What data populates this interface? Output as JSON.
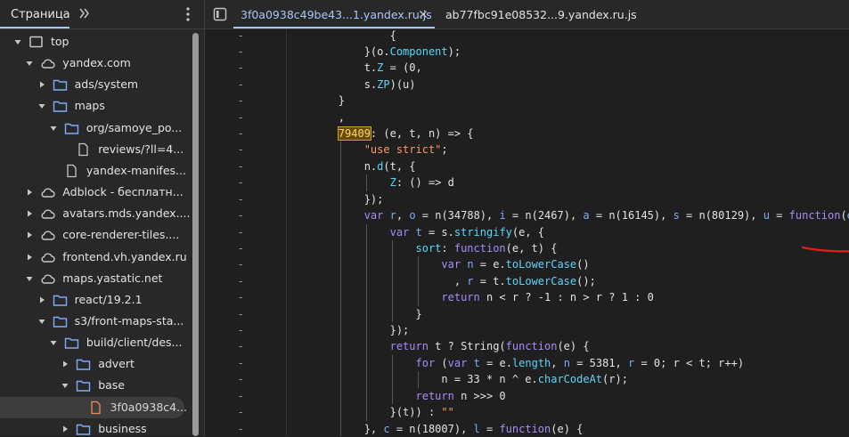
{
  "navigator": {
    "tab_label": "Страница",
    "tree": [
      {
        "label": "top",
        "icon": "frame-icon",
        "indent": 0,
        "arrow": "down"
      },
      {
        "label": "yandex.com",
        "icon": "cloud-icon",
        "indent": 1,
        "arrow": "down"
      },
      {
        "label": "ads/system",
        "icon": "folder-icon",
        "indent": 2,
        "arrow": "right"
      },
      {
        "label": "maps",
        "icon": "folder-icon",
        "indent": 2,
        "arrow": "down"
      },
      {
        "label": "org/samoye_po...",
        "icon": "folder-icon",
        "indent": 3,
        "arrow": "down"
      },
      {
        "label": "reviews/?ll=4...",
        "icon": "file-icon",
        "indent": 4,
        "arrow": "none"
      },
      {
        "label": "yandex-manifes...",
        "icon": "file-icon",
        "indent": 3,
        "arrow": "none"
      },
      {
        "label": "Adblock - бесплатн...",
        "icon": "cloud-icon",
        "indent": 1,
        "arrow": "right"
      },
      {
        "label": "avatars.mds.yandex....",
        "icon": "cloud-icon",
        "indent": 1,
        "arrow": "right"
      },
      {
        "label": "core-renderer-tiles....",
        "icon": "cloud-icon",
        "indent": 1,
        "arrow": "right"
      },
      {
        "label": "frontend.vh.yandex.ru",
        "icon": "cloud-icon",
        "indent": 1,
        "arrow": "right"
      },
      {
        "label": "maps.yastatic.net",
        "icon": "cloud-icon",
        "indent": 1,
        "arrow": "down"
      },
      {
        "label": "react/19.2.1",
        "icon": "folder-icon",
        "indent": 2,
        "arrow": "right"
      },
      {
        "label": "s3/front-maps-sta...",
        "icon": "folder-icon",
        "indent": 2,
        "arrow": "down"
      },
      {
        "label": "build/client/des...",
        "icon": "folder-icon",
        "indent": 3,
        "arrow": "down"
      },
      {
        "label": "advert",
        "icon": "folder-icon",
        "indent": 4,
        "arrow": "right"
      },
      {
        "label": "base",
        "icon": "folder-icon",
        "indent": 4,
        "arrow": "down"
      },
      {
        "label": "3f0a0938c4...",
        "icon": "js-file-icon",
        "indent": 5,
        "arrow": "none",
        "selected": true
      },
      {
        "label": "business",
        "icon": "folder-icon",
        "indent": 4,
        "arrow": "right"
      }
    ]
  },
  "editor": {
    "tabs": [
      {
        "label": "3f0a0938c49be43...1.yandex.ru.js",
        "active": true
      },
      {
        "label": "ab77fbc91e08532...9.yandex.ru.js",
        "active": false
      }
    ],
    "gutter_mark": "-",
    "code_lines": [
      {
        "indent": 0,
        "guides": [],
        "tokens": [
          {
            "t": "                {",
            "c": "n"
          }
        ]
      },
      {
        "indent": 0,
        "guides": [],
        "tokens": [
          {
            "t": "            }(o.",
            "c": "n"
          },
          {
            "t": "Component",
            "c": "p"
          },
          {
            "t": ");",
            "c": "n"
          }
        ]
      },
      {
        "indent": 0,
        "guides": [],
        "tokens": [
          {
            "t": "            t.",
            "c": "n"
          },
          {
            "t": "Z",
            "c": "p"
          },
          {
            "t": " = (0,",
            "c": "n"
          }
        ]
      },
      {
        "indent": 0,
        "guides": [],
        "tokens": [
          {
            "t": "            s.",
            "c": "n"
          },
          {
            "t": "ZP",
            "c": "p"
          },
          {
            "t": ")(u)",
            "c": "n"
          }
        ]
      },
      {
        "indent": 0,
        "guides": [],
        "tokens": [
          {
            "t": "        }",
            "c": "n"
          }
        ]
      },
      {
        "indent": 0,
        "guides": [],
        "tokens": [
          {
            "t": "        ,",
            "c": "n"
          }
        ]
      },
      {
        "indent": 0,
        "guides": [],
        "tokens": [
          {
            "t": "        ",
            "c": "n"
          },
          {
            "t": "79409",
            "c": "hl"
          },
          {
            "t": ": (e, t, n) => {",
            "c": "n"
          }
        ]
      },
      {
        "indent": 0,
        "guides": [
          1
        ],
        "tokens": [
          {
            "t": "            ",
            "c": "n"
          },
          {
            "t": "\"use strict\"",
            "c": "s"
          },
          {
            "t": ";",
            "c": "n"
          }
        ]
      },
      {
        "indent": 0,
        "guides": [
          1
        ],
        "tokens": [
          {
            "t": "            n.",
            "c": "n"
          },
          {
            "t": "d",
            "c": "p"
          },
          {
            "t": "(t, {",
            "c": "n"
          }
        ]
      },
      {
        "indent": 0,
        "guides": [
          1,
          2
        ],
        "tokens": [
          {
            "t": "                ",
            "c": "n"
          },
          {
            "t": "Z",
            "c": "p"
          },
          {
            "t": ": () => d",
            "c": "n"
          }
        ]
      },
      {
        "indent": 0,
        "guides": [
          1
        ],
        "tokens": [
          {
            "t": "            });",
            "c": "n"
          }
        ]
      },
      {
        "indent": 0,
        "guides": [
          1
        ],
        "tokens": [
          {
            "t": "            ",
            "c": "n"
          },
          {
            "t": "var",
            "c": "k"
          },
          {
            "t": " ",
            "c": "n"
          },
          {
            "t": "r",
            "c": "v"
          },
          {
            "t": ", ",
            "c": "n"
          },
          {
            "t": "o",
            "c": "v"
          },
          {
            "t": " = n(34788), ",
            "c": "n"
          },
          {
            "t": "i",
            "c": "v"
          },
          {
            "t": " = n(2467), ",
            "c": "n"
          },
          {
            "t": "a",
            "c": "v"
          },
          {
            "t": " = n(16145), ",
            "c": "n"
          },
          {
            "t": "s",
            "c": "v"
          },
          {
            "t": " = n(80129), ",
            "c": "n"
          },
          {
            "t": "u",
            "c": "v"
          },
          {
            "t": " = ",
            "c": "n"
          },
          {
            "t": "function",
            "c": "k"
          },
          {
            "t": "(",
            "c": "n"
          },
          {
            "t": "e",
            "c": "v"
          },
          {
            "t": ") {",
            "c": "n"
          }
        ]
      },
      {
        "indent": 0,
        "guides": [
          1,
          2
        ],
        "tokens": [
          {
            "t": "                ",
            "c": "n"
          },
          {
            "t": "var",
            "c": "k"
          },
          {
            "t": " ",
            "c": "n"
          },
          {
            "t": "t",
            "c": "v"
          },
          {
            "t": " = s.",
            "c": "n"
          },
          {
            "t": "stringify",
            "c": "p"
          },
          {
            "t": "(e, {",
            "c": "n"
          }
        ]
      },
      {
        "indent": 0,
        "guides": [
          1,
          2,
          3
        ],
        "tokens": [
          {
            "t": "                    ",
            "c": "n"
          },
          {
            "t": "sort",
            "c": "p"
          },
          {
            "t": ": ",
            "c": "n"
          },
          {
            "t": "function",
            "c": "k"
          },
          {
            "t": "(e, t) {",
            "c": "n"
          }
        ]
      },
      {
        "indent": 0,
        "guides": [
          1,
          2,
          3,
          4
        ],
        "tokens": [
          {
            "t": "                        ",
            "c": "n"
          },
          {
            "t": "var",
            "c": "k"
          },
          {
            "t": " ",
            "c": "n"
          },
          {
            "t": "n",
            "c": "v"
          },
          {
            "t": " = e.",
            "c": "n"
          },
          {
            "t": "toLowerCase",
            "c": "p"
          },
          {
            "t": "()",
            "c": "n"
          }
        ]
      },
      {
        "indent": 0,
        "guides": [
          1,
          2,
          3,
          4
        ],
        "tokens": [
          {
            "t": "                          , ",
            "c": "n"
          },
          {
            "t": "r",
            "c": "v"
          },
          {
            "t": " = t.",
            "c": "n"
          },
          {
            "t": "toLowerCase",
            "c": "p"
          },
          {
            "t": "();",
            "c": "n"
          }
        ]
      },
      {
        "indent": 0,
        "guides": [
          1,
          2,
          3,
          4
        ],
        "tokens": [
          {
            "t": "                        ",
            "c": "n"
          },
          {
            "t": "return",
            "c": "k"
          },
          {
            "t": " n < r ? -1 : n > r ? 1 : 0",
            "c": "n"
          }
        ]
      },
      {
        "indent": 0,
        "guides": [
          1,
          2,
          3
        ],
        "tokens": [
          {
            "t": "                    }",
            "c": "n"
          }
        ]
      },
      {
        "indent": 0,
        "guides": [
          1,
          2
        ],
        "tokens": [
          {
            "t": "                });",
            "c": "n"
          }
        ]
      },
      {
        "indent": 0,
        "guides": [
          1,
          2
        ],
        "tokens": [
          {
            "t": "                ",
            "c": "n"
          },
          {
            "t": "return",
            "c": "k"
          },
          {
            "t": " t ? String(",
            "c": "n"
          },
          {
            "t": "function",
            "c": "k"
          },
          {
            "t": "(e) {",
            "c": "n"
          }
        ]
      },
      {
        "indent": 0,
        "guides": [
          1,
          2,
          3
        ],
        "tokens": [
          {
            "t": "                    ",
            "c": "n"
          },
          {
            "t": "for",
            "c": "k"
          },
          {
            "t": " (",
            "c": "n"
          },
          {
            "t": "var",
            "c": "k"
          },
          {
            "t": " ",
            "c": "n"
          },
          {
            "t": "t",
            "c": "v"
          },
          {
            "t": " = e.",
            "c": "n"
          },
          {
            "t": "length",
            "c": "p"
          },
          {
            "t": ", ",
            "c": "n"
          },
          {
            "t": "n",
            "c": "v"
          },
          {
            "t": " = 5381, ",
            "c": "n"
          },
          {
            "t": "r",
            "c": "v"
          },
          {
            "t": " = 0; r < t; r++)",
            "c": "n"
          }
        ]
      },
      {
        "indent": 0,
        "guides": [
          1,
          2,
          3,
          4
        ],
        "tokens": [
          {
            "t": "                        n = 33 * n ^ e.",
            "c": "n"
          },
          {
            "t": "charCodeAt",
            "c": "p"
          },
          {
            "t": "(r);",
            "c": "n"
          }
        ]
      },
      {
        "indent": 0,
        "guides": [
          1,
          2,
          3
        ],
        "tokens": [
          {
            "t": "                    ",
            "c": "n"
          },
          {
            "t": "return",
            "c": "k"
          },
          {
            "t": " n >>> 0",
            "c": "n"
          }
        ]
      },
      {
        "indent": 0,
        "guides": [
          1,
          2
        ],
        "tokens": [
          {
            "t": "                }(t)) : ",
            "c": "n"
          },
          {
            "t": "\"\"",
            "c": "s"
          }
        ]
      },
      {
        "indent": 0,
        "guides": [
          1
        ],
        "tokens": [
          {
            "t": "            }, ",
            "c": "n"
          },
          {
            "t": "c",
            "c": "v"
          },
          {
            "t": " = n(18007), ",
            "c": "n"
          },
          {
            "t": "l",
            "c": "v"
          },
          {
            "t": " = ",
            "c": "n"
          },
          {
            "t": "function",
            "c": "k"
          },
          {
            "t": "(e) {",
            "c": "n"
          }
        ]
      }
    ]
  },
  "colors": {
    "accent": "#a8c7fa",
    "annotation": "#e0201a",
    "highlight": "#c9a227"
  }
}
